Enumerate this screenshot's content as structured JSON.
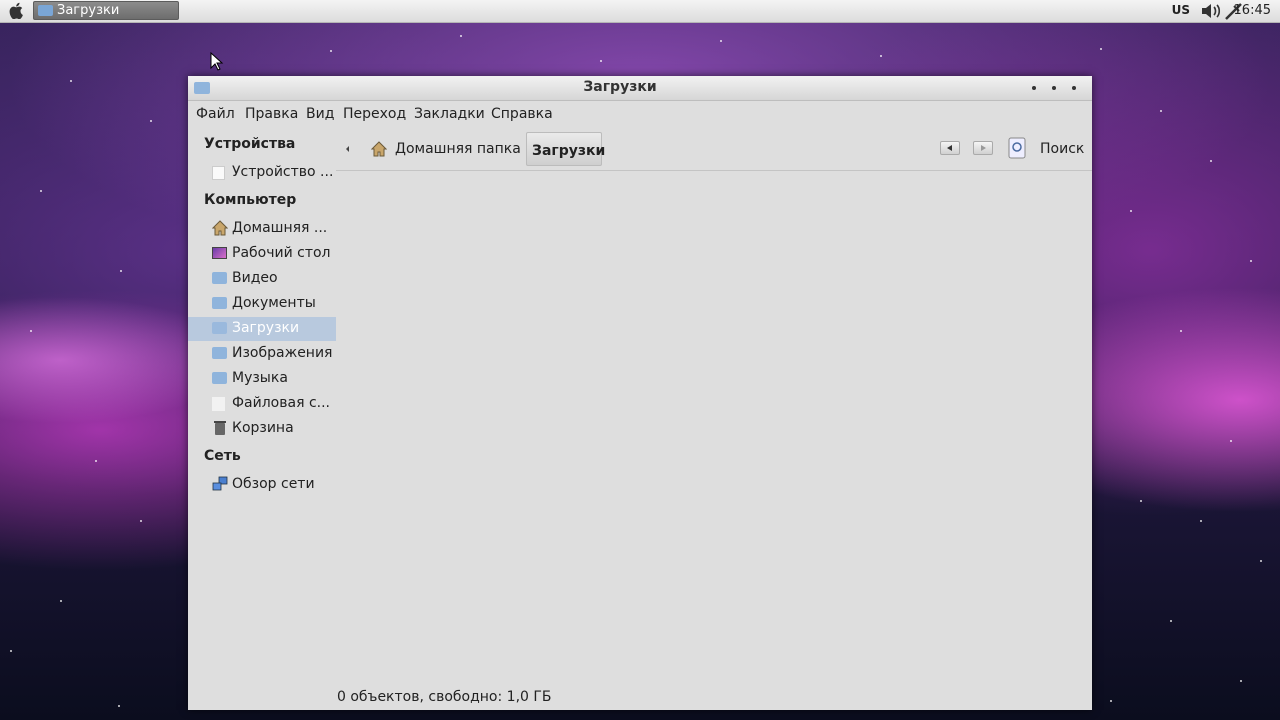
{
  "top_panel": {
    "apple_icon": "apple-logo-icon",
    "task_button_label": "Загрузки",
    "keyboard_layout": "US",
    "clock": "16:45"
  },
  "window": {
    "title": "Загрузки",
    "menu": [
      "Файл",
      "Правка",
      "Вид",
      "Переход",
      "Закладки",
      "Справка"
    ],
    "sidebar": {
      "devices_heading": "Устройства",
      "devices": [
        {
          "label": "Устройство ...",
          "icon": "drive-icon"
        }
      ],
      "computer_heading": "Компьютер",
      "computer": [
        {
          "label": "Домашняя ...",
          "icon": "home-icon"
        },
        {
          "label": "Рабочий стол",
          "icon": "desktop-icon"
        },
        {
          "label": "Видео",
          "icon": "folder-icon"
        },
        {
          "label": "Документы",
          "icon": "folder-icon"
        },
        {
          "label": "Загрузки",
          "icon": "folder-icon",
          "selected": true
        },
        {
          "label": "Изображения",
          "icon": "folder-icon"
        },
        {
          "label": "Музыка",
          "icon": "folder-icon"
        },
        {
          "label": "Файловая с...",
          "icon": "filesystem-icon"
        },
        {
          "label": "Корзина",
          "icon": "trash-icon"
        }
      ],
      "network_heading": "Сеть",
      "network": [
        {
          "label": "Обзор сети",
          "icon": "network-icon"
        }
      ]
    },
    "pathbar": {
      "home_label": "Домашняя папка",
      "current_label": "Загрузки",
      "search_label": "Поиск"
    },
    "status": "0 объектов, свободно: 1,0 ГБ"
  },
  "colors": {
    "selection": "#b8c9de",
    "window_bg": "#dedede",
    "folder": "#8fb4dc"
  }
}
